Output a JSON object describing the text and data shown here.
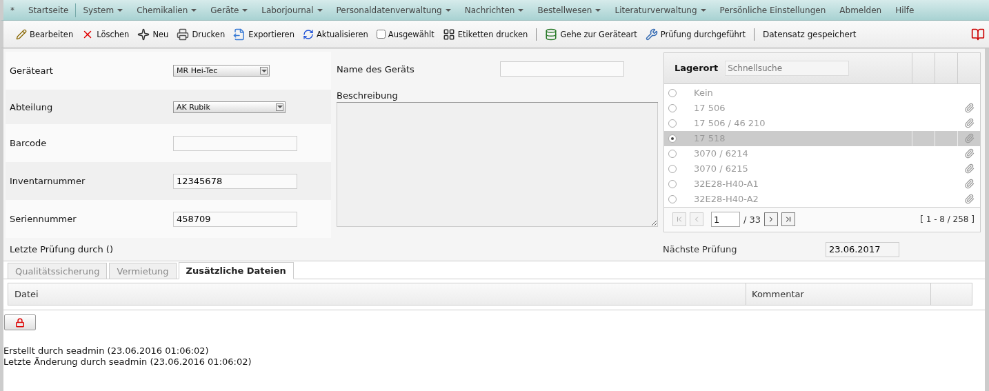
{
  "menu": [
    {
      "label": "*",
      "dropdown": false
    },
    {
      "label": "Startseite",
      "dropdown": false
    },
    {
      "label": "System",
      "dropdown": true
    },
    {
      "label": "Chemikalien",
      "dropdown": true
    },
    {
      "label": "Geräte",
      "dropdown": true
    },
    {
      "label": "Laborjournal",
      "dropdown": true
    },
    {
      "label": "Personaldatenverwaltung",
      "dropdown": true
    },
    {
      "label": "Nachrichten",
      "dropdown": true
    },
    {
      "label": "Bestellwesen",
      "dropdown": true
    },
    {
      "label": "Literaturverwaltung",
      "dropdown": true
    },
    {
      "label": "Persönliche Einstellungen",
      "dropdown": false
    },
    {
      "label": "Abmelden",
      "dropdown": false
    },
    {
      "label": "Hilfe",
      "dropdown": false
    }
  ],
  "toolbar": [
    {
      "kind": "button",
      "label": "Bearbeiten"
    },
    {
      "kind": "button",
      "label": "Löschen"
    },
    {
      "kind": "button",
      "label": "Neu"
    },
    {
      "kind": "button",
      "label": "Drucken"
    },
    {
      "kind": "button",
      "label": "Exportieren"
    },
    {
      "kind": "button",
      "label": "Aktualisieren"
    },
    {
      "kind": "checkbox",
      "label": "Ausgewählt",
      "checked": false
    },
    {
      "kind": "button",
      "label": "Etiketten drucken"
    },
    {
      "kind": "separator"
    },
    {
      "kind": "button",
      "label": "Gehe zur Geräteart"
    },
    {
      "kind": "button",
      "label": "Prüfung durchgeführt"
    },
    {
      "kind": "separator"
    },
    {
      "kind": "status",
      "label": "Datensatz gespeichert"
    }
  ],
  "fields": [
    {
      "label": "Geräteart",
      "kind": "select",
      "value": "MR Hei-Tec"
    },
    {
      "label": "Abteilung",
      "kind": "select",
      "value": "AK Rubik"
    },
    {
      "label": "Barcode",
      "kind": "text"
    },
    {
      "label": "Inventarnummer",
      "kind": "text",
      "value": "12345678"
    },
    {
      "label": "Seriennummer",
      "kind": "text",
      "value": "458709"
    }
  ],
  "name_field": {
    "label": "Name des Geräts"
  },
  "description": {
    "label": "Beschreibung"
  },
  "storage": {
    "title": "Lagerort",
    "search": {
      "placeholder": "Schnellsuche"
    },
    "rows": [
      {
        "label": "Kein",
        "selected": false,
        "attachment": false
      },
      {
        "label": "17 506",
        "selected": false,
        "attachment": true
      },
      {
        "label": "17 506 / 46 210",
        "selected": false,
        "attachment": true
      },
      {
        "label": "17 518",
        "selected": true,
        "attachment": true
      },
      {
        "label": "3070 / 6214",
        "selected": false,
        "attachment": true
      },
      {
        "label": "3070 / 6215",
        "selected": false,
        "attachment": true
      },
      {
        "label": "32E28-H40-A1",
        "selected": false,
        "attachment": true
      },
      {
        "label": "32E28-H40-A2",
        "selected": false,
        "attachment": true
      }
    ],
    "pager": {
      "page": "1",
      "total": "/ 33",
      "range": "[ 1 - 8 / 258 ]"
    }
  },
  "last_check": "Letzte Prüfung durch ()",
  "next_check": {
    "label": "Nächste Prüfung",
    "value": "23.06.2017"
  },
  "tabs": [
    {
      "label": "Qualitätssicherung",
      "selected": false
    },
    {
      "label": "Vermietung",
      "selected": false
    },
    {
      "label": "Zusätzliche Dateien",
      "selected": true
    }
  ],
  "files_table": {
    "columns": [
      "Datei",
      "Kommentar"
    ]
  },
  "footer": [
    "Erstellt durch seadmin (23.06.2016 01:06:02)",
    "Letzte Änderung durch seadmin (23.06.2016 01:06:02)"
  ]
}
